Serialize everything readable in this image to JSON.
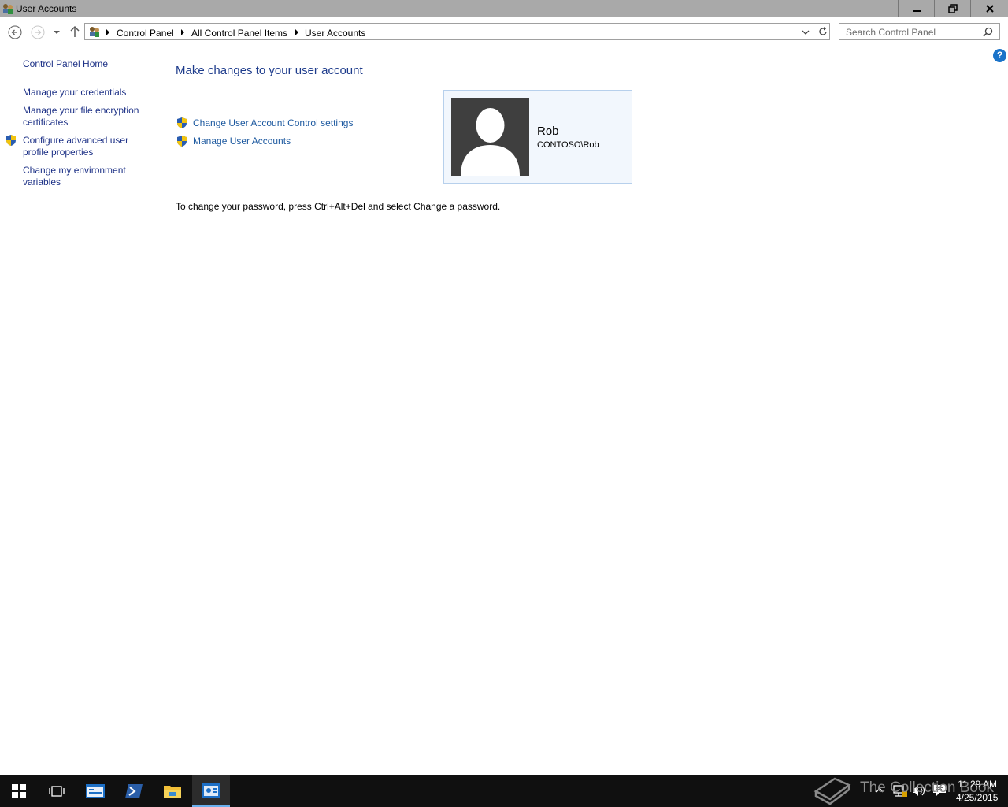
{
  "window": {
    "title": "User Accounts",
    "controls": {
      "minimize": "minimize",
      "maximize": "restore",
      "close": "close"
    }
  },
  "address_bar": {
    "breadcrumbs": [
      "Control Panel",
      "All Control Panel Items",
      "User Accounts"
    ]
  },
  "search": {
    "placeholder": "Search Control Panel"
  },
  "left_pane": {
    "home": "Control Panel Home",
    "links": [
      "Manage your credentials",
      "Manage your file encryption certificates",
      "Configure advanced user profile properties",
      "Change my environment variables"
    ]
  },
  "main": {
    "title": "Make changes to your user account",
    "links": [
      "Change User Account Control settings",
      "Manage User Accounts"
    ],
    "user": {
      "name": "Rob",
      "domain": "CONTOSO\\Rob"
    },
    "password_hint": "To change your password, press Ctrl+Alt+Del and select Change a password."
  },
  "taskbar": {
    "watermark": "The Collection Book",
    "time": "11:29 AM",
    "date": "4/25/2015"
  },
  "colors": {
    "link": "#1e5aa0",
    "title": "#1e3c8c",
    "titlebar": "#a9a9a9",
    "taskbar": "#101010"
  }
}
